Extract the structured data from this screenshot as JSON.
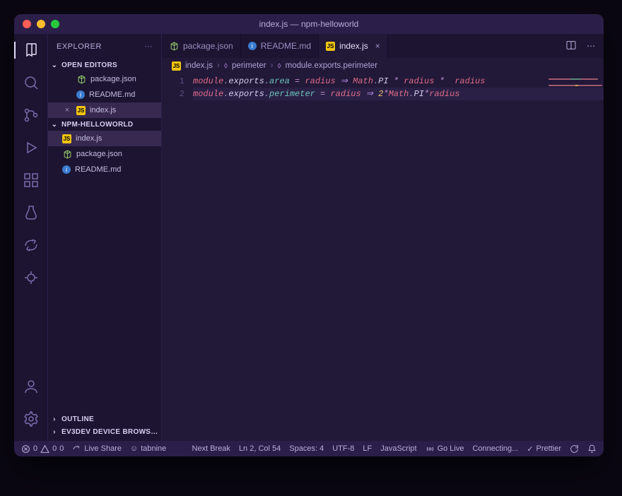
{
  "title": "index.js — npm-helloworld",
  "sidebar": {
    "title": "EXPLORER",
    "open_editors_label": "OPEN EDITORS",
    "project_label": "NPM-HELLOWORLD",
    "open_editors": [
      {
        "name": "package.json",
        "icon": "pkg"
      },
      {
        "name": "README.md",
        "icon": "md"
      },
      {
        "name": "index.js",
        "icon": "js",
        "active": true
      }
    ],
    "files": [
      {
        "name": "index.js",
        "icon": "js",
        "selected": true
      },
      {
        "name": "package.json",
        "icon": "pkg"
      },
      {
        "name": "README.md",
        "icon": "md"
      }
    ],
    "outline_label": "OUTLINE",
    "ev3_label": "EV3DEV DEVICE BROWS…"
  },
  "tabs": [
    {
      "name": "package.json",
      "icon": "pkg"
    },
    {
      "name": "README.md",
      "icon": "md"
    },
    {
      "name": "index.js",
      "icon": "js",
      "active": true
    }
  ],
  "breadcrumbs": {
    "file_icon": "js",
    "file": "index.js",
    "sym1": "perimeter",
    "sym2": "module.exports.perimeter"
  },
  "editor": {
    "lines": [
      {
        "no": "1",
        "tokens": [
          {
            "t": "module",
            "c": "c-red"
          },
          {
            "t": ".",
            "c": "c-dot"
          },
          {
            "t": "exports",
            "c": "c-prop"
          },
          {
            "t": ".",
            "c": "c-dot"
          },
          {
            "t": "area",
            "c": "c-teal"
          },
          {
            "t": " = ",
            "c": "c-op"
          },
          {
            "t": "radius",
            "c": "c-red"
          },
          {
            "t": " ⇒ ",
            "c": "c-kw"
          },
          {
            "t": "Math",
            "c": "c-red"
          },
          {
            "t": ".",
            "c": "c-dot"
          },
          {
            "t": "PI",
            "c": "c-prop"
          },
          {
            "t": " * ",
            "c": "c-op"
          },
          {
            "t": "radius",
            "c": "c-red"
          },
          {
            "t": " * ",
            "c": "c-op"
          },
          {
            "t": " radius",
            "c": "c-red"
          }
        ]
      },
      {
        "no": "2",
        "hl": true,
        "tokens": [
          {
            "t": "module",
            "c": "c-red"
          },
          {
            "t": ".",
            "c": "c-dot"
          },
          {
            "t": "exports",
            "c": "c-prop"
          },
          {
            "t": ".",
            "c": "c-dot"
          },
          {
            "t": "perimeter",
            "c": "c-teal"
          },
          {
            "t": " = ",
            "c": "c-op"
          },
          {
            "t": "radius",
            "c": "c-red"
          },
          {
            "t": " ⇒ ",
            "c": "c-kw"
          },
          {
            "t": "2",
            "c": "c-num"
          },
          {
            "t": "*",
            "c": "c-op"
          },
          {
            "t": "Math",
            "c": "c-red"
          },
          {
            "t": ".",
            "c": "c-dot"
          },
          {
            "t": "PI",
            "c": "c-prop"
          },
          {
            "t": "*",
            "c": "c-op"
          },
          {
            "t": "radius",
            "c": "c-red"
          }
        ]
      }
    ]
  },
  "status": {
    "errors": "0",
    "warnings": "0",
    "notifications": "0",
    "live_share": "Live Share",
    "tabnine": "tabnine",
    "next_break": "Next Break",
    "cursor": "Ln 2, Col 54",
    "spaces": "Spaces: 4",
    "encoding": "UTF-8",
    "eol": "LF",
    "language": "JavaScript",
    "go_live": "Go Live",
    "connecting": "Connecting...",
    "prettier": "Prettier"
  }
}
